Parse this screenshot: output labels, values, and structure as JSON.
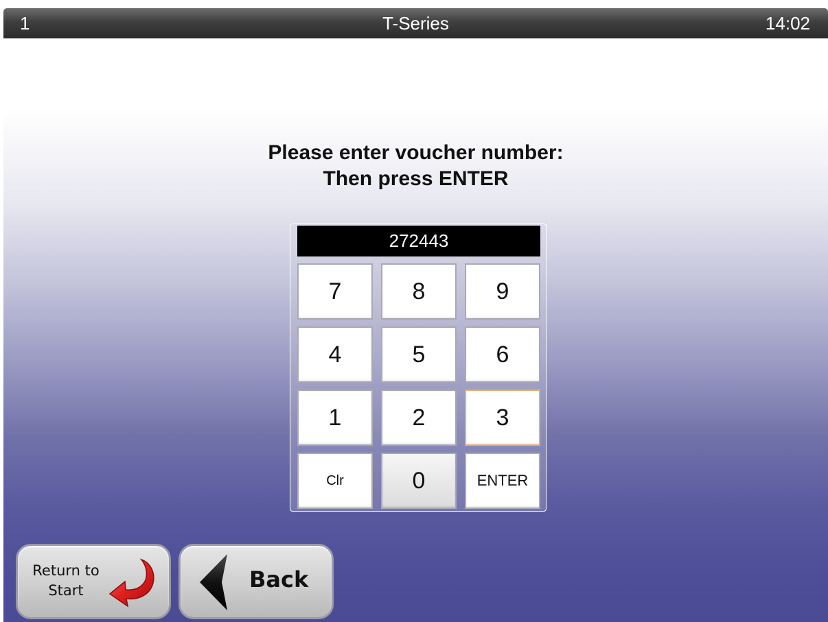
{
  "titlebar": {
    "terminal": "1",
    "title": "T-Series",
    "clock": "14:02"
  },
  "prompt": {
    "line1": "Please enter voucher number:",
    "line2": "Then press ENTER"
  },
  "keypad": {
    "display_value": "272443",
    "keys": {
      "k7": "7",
      "k8": "8",
      "k9": "9",
      "k4": "4",
      "k5": "5",
      "k6": "6",
      "k1": "1",
      "k2": "2",
      "k3": "3",
      "clear": "Clr",
      "k0": "0",
      "enter": "ENTER"
    }
  },
  "nav": {
    "return_line1": "Return to",
    "return_line2": "Start",
    "return_icon": "curved-return-arrow-icon",
    "back_label": "Back",
    "back_icon": "left-triangle-arrow-icon"
  },
  "colors": {
    "titlebar": "#3f3f3f",
    "gradient_bottom": "#4b4b95",
    "display_bg": "#000000",
    "return_arrow": "#d42020",
    "focus_border": "#e3b06f"
  }
}
